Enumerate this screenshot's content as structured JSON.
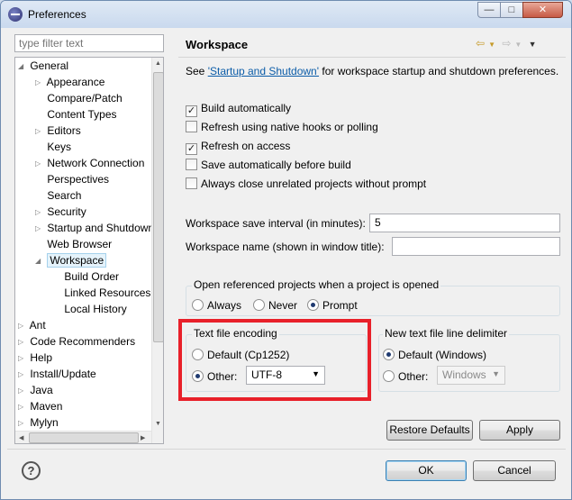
{
  "window": {
    "title": "Preferences",
    "minimize": "—",
    "maximize": "□",
    "close": "✕"
  },
  "filter": {
    "placeholder": "type filter text"
  },
  "tree": [
    {
      "label": "General",
      "expanded": true
    },
    {
      "label": "Appearance"
    },
    {
      "label": "Compare/Patch"
    },
    {
      "label": "Content Types"
    },
    {
      "label": "Editors"
    },
    {
      "label": "Keys"
    },
    {
      "label": "Network Connection"
    },
    {
      "label": "Perspectives"
    },
    {
      "label": "Search"
    },
    {
      "label": "Security"
    },
    {
      "label": "Startup and Shutdown"
    },
    {
      "label": "Web Browser"
    },
    {
      "label": "Workspace",
      "selected": true
    },
    {
      "label": "Build Order"
    },
    {
      "label": "Linked Resources"
    },
    {
      "label": "Local History"
    },
    {
      "label": "Ant"
    },
    {
      "label": "Code Recommenders"
    },
    {
      "label": "Help"
    },
    {
      "label": "Install/Update"
    },
    {
      "label": "Java"
    },
    {
      "label": "Maven"
    },
    {
      "label": "Mylyn"
    }
  ],
  "panel": {
    "title": "Workspace",
    "see_prefix": "See ",
    "see_link": "'Startup and Shutdown'",
    "see_suffix": " for workspace startup and shutdown preferences.",
    "checks": [
      {
        "label": "Build automatically",
        "checked": true
      },
      {
        "label": "Refresh using native hooks or polling",
        "checked": false
      },
      {
        "label": "Refresh on access",
        "checked": true
      },
      {
        "label": "Save automatically before build",
        "checked": false
      },
      {
        "label": "Always close unrelated projects without prompt",
        "checked": false
      }
    ],
    "save_interval_label": "Workspace save interval (in minutes):",
    "save_interval_value": "5",
    "workspace_name_label": "Workspace name (shown in window title):",
    "workspace_name_value": "",
    "open_ref_title": "Open referenced projects when a project is opened",
    "open_ref_options": [
      "Always",
      "Never",
      "Prompt"
    ],
    "encoding_title": "Text file encoding",
    "encoding_default": "Default (Cp1252)",
    "encoding_other": "Other:",
    "encoding_value": "UTF-8",
    "delimiter_title": "New text file line delimiter",
    "delimiter_default": "Default (Windows)",
    "delimiter_other": "Other:",
    "delimiter_value": "Windows",
    "restore_defaults": "Restore Defaults",
    "apply": "Apply"
  },
  "footer": {
    "ok": "OK",
    "cancel": "Cancel",
    "help": "?"
  }
}
